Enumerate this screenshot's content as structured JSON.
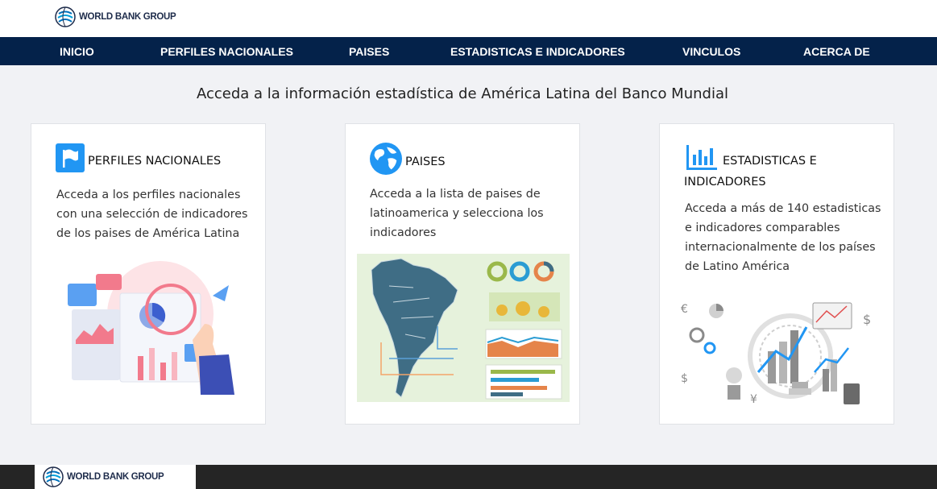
{
  "header": {
    "logo_text": "WORLD BANK GROUP"
  },
  "nav": {
    "items": [
      {
        "label": "INICIO"
      },
      {
        "label": "PERFILES NACIONALES"
      },
      {
        "label": "PAISES"
      },
      {
        "label": "ESTADISTICAS E INDICADORES"
      },
      {
        "label": "VINCULOS"
      },
      {
        "label": "ACERCA DE"
      }
    ]
  },
  "main": {
    "headline": "Acceda a la información estadística de América Latina del Banco Mundial",
    "cards": [
      {
        "title": "PERFILES NACIONALES",
        "description": "Acceda a los perfiles nacionales con una selección de indicadores de los paises de América Latina",
        "icon": "flag-icon"
      },
      {
        "title": "PAISES",
        "description": "Acceda a la lista de paises de latinoamerica y selecciona los indicadores",
        "icon": "globe-icon"
      },
      {
        "title_line1": "ESTADISTICAS E",
        "title_line2": "INDICADORES",
        "description": "Acceda a más de 140 estadisticas e indicadores comparables internacionalmente de los países de Latino América",
        "icon": "bar-chart-icon"
      }
    ]
  },
  "footer": {
    "logo_text": "WORLD BANK GROUP"
  },
  "colors": {
    "nav_bg": "#04224a",
    "accent_blue": "#2196f3",
    "page_bg": "#f1f2f5",
    "footer_bg": "#252525"
  }
}
